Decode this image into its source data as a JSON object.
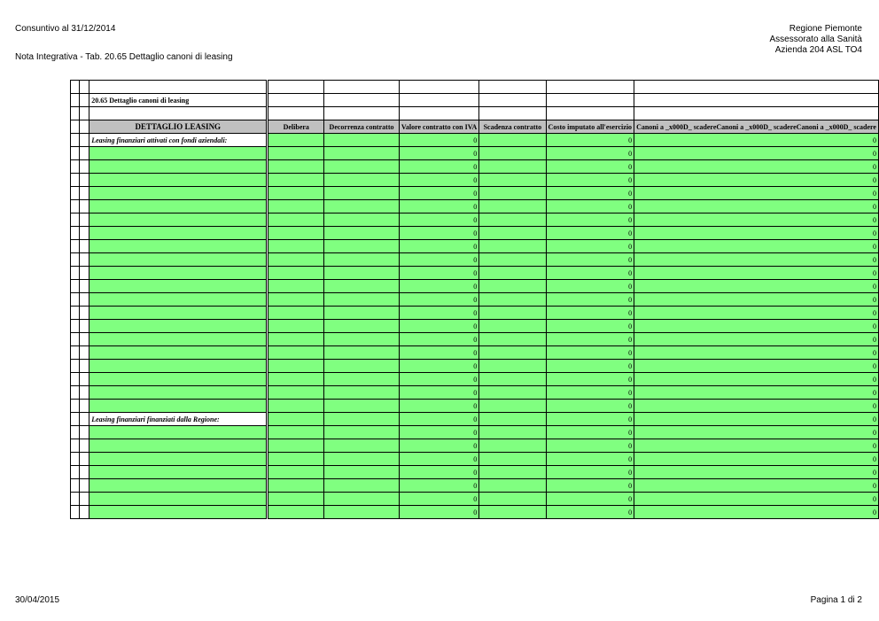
{
  "page": {
    "report_title": "Consuntivo al 31/12/2014",
    "subtitle": "Nota Integrativa - Tab. 20.65  Dettaglio canoni di leasing",
    "org_line1": "Regione Piemonte",
    "org_line2": "Assessorato alla Sanità",
    "org_line3": "Azienda 204 ASL TO4",
    "date": "30/04/2015",
    "page_number": "Pagina 1 di 2"
  },
  "table": {
    "title": "20.65  Dettaglio canoni di leasing",
    "headers": {
      "dettaglio": "DETTAGLIO LEASING",
      "delibera": "Delibera",
      "decorrenza": "Decorrenza contratto",
      "valore": "Valore contratto con IVA",
      "scadenza": "Scadenza contratto",
      "costo": "Costo imputato all'esercizio",
      "canoni": "Canoni a _x000D_ scadereCanoni a _x000D_ scadereCanoni a _x000D_ scadere"
    },
    "section1_label": "Leasing finanziari attivati con fondi aziendali:",
    "section2_label": "Leasing finanziari finanziati dalla Regione:",
    "rows_section1": [
      {
        "valore": "0",
        "costo": "0",
        "canoni": "0"
      },
      {
        "valore": "0",
        "costo": "0",
        "canoni": "0"
      },
      {
        "valore": "0",
        "costo": "0",
        "canoni": "0"
      },
      {
        "valore": "0",
        "costo": "0",
        "canoni": "0"
      },
      {
        "valore": "0",
        "costo": "0",
        "canoni": "0"
      },
      {
        "valore": "0",
        "costo": "0",
        "canoni": "0"
      },
      {
        "valore": "0",
        "costo": "0",
        "canoni": "0"
      },
      {
        "valore": "0",
        "costo": "0",
        "canoni": "0"
      },
      {
        "valore": "0",
        "costo": "0",
        "canoni": "0"
      },
      {
        "valore": "0",
        "costo": "0",
        "canoni": "0"
      },
      {
        "valore": "0",
        "costo": "0",
        "canoni": "0"
      },
      {
        "valore": "0",
        "costo": "0",
        "canoni": "0"
      },
      {
        "valore": "0",
        "costo": "0",
        "canoni": "0"
      },
      {
        "valore": "0",
        "costo": "0",
        "canoni": "0"
      },
      {
        "valore": "0",
        "costo": "0",
        "canoni": "0"
      },
      {
        "valore": "0",
        "costo": "0",
        "canoni": "0"
      },
      {
        "valore": "0",
        "costo": "0",
        "canoni": "0"
      },
      {
        "valore": "0",
        "costo": "0",
        "canoni": "0"
      },
      {
        "valore": "0",
        "costo": "0",
        "canoni": "0"
      },
      {
        "valore": "0",
        "costo": "0",
        "canoni": "0"
      },
      {
        "valore": "0",
        "costo": "0",
        "canoni": "0"
      }
    ],
    "rows_section2": [
      {
        "valore": "0",
        "costo": "0",
        "canoni": "0"
      },
      {
        "valore": "0",
        "costo": "0",
        "canoni": "0"
      },
      {
        "valore": "0",
        "costo": "0",
        "canoni": "0"
      },
      {
        "valore": "0",
        "costo": "0",
        "canoni": "0"
      },
      {
        "valore": "0",
        "costo": "0",
        "canoni": "0"
      },
      {
        "valore": "0",
        "costo": "0",
        "canoni": "0"
      },
      {
        "valore": "0",
        "costo": "0",
        "canoni": "0"
      },
      {
        "valore": "0",
        "costo": "0",
        "canoni": "0"
      }
    ]
  },
  "colors": {
    "header_gray": "#c0c0c0",
    "input_green": "#80ff80"
  }
}
